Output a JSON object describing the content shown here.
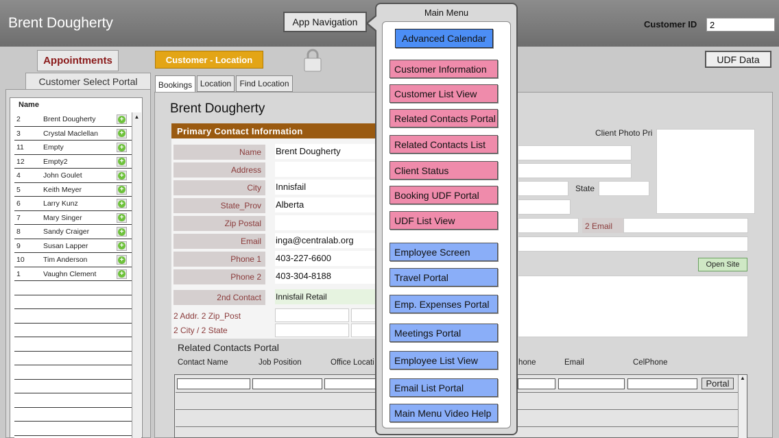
{
  "header": {
    "title": "Brent Dougherty",
    "nav_button": "App Navigation",
    "customer_id_label": "Customer ID",
    "customer_id_value": "2"
  },
  "subbar": {
    "appointments_tab": "Appointments",
    "customer_location": "Customer - Location",
    "udf_button": "UDF Data"
  },
  "left": {
    "portal_label": "Customer Select Portal",
    "list_header": "Name",
    "rows": [
      {
        "id": "2",
        "name": "Brent Dougherty"
      },
      {
        "id": "3",
        "name": "Crystal Maclellan"
      },
      {
        "id": "11",
        "name": "Empty"
      },
      {
        "id": "12",
        "name": "Empty2"
      },
      {
        "id": "4",
        "name": "John Goulet"
      },
      {
        "id": "5",
        "name": "Keith Meyer"
      },
      {
        "id": "6",
        "name": "Larry Kunz"
      },
      {
        "id": "7",
        "name": "Mary Singer"
      },
      {
        "id": "8",
        "name": "Sandy Craiger"
      },
      {
        "id": "9",
        "name": "Susan Lapper"
      },
      {
        "id": "10",
        "name": "Tim Anderson"
      },
      {
        "id": "1",
        "name": "Vaughn Clement"
      }
    ]
  },
  "tabs": [
    "Bookings",
    "Location",
    "Find Location"
  ],
  "main": {
    "person_name": "Brent Dougherty",
    "section_title": "Primary Contact  Information",
    "fields": [
      {
        "label": "Name",
        "value": "Brent Dougherty"
      },
      {
        "label": "Address",
        "value": ""
      },
      {
        "label": "City",
        "value": "Innisfail"
      },
      {
        "label": "State_Prov",
        "value": "Alberta"
      },
      {
        "label": "Zip Postal",
        "value": ""
      },
      {
        "label": "Email",
        "value": "inga@centralab.org"
      },
      {
        "label": "Phone 1",
        "value": "403-227-6600"
      },
      {
        "label": "Phone 2",
        "value": "403-304-8188"
      },
      {
        "label": "2nd  Contact",
        "value": "Innisfail Retail"
      }
    ],
    "addr2_label": "2 Addr. 2 Zip_Post",
    "city2_label": "2 City / 2 State",
    "client_photo_label": "Client Photo Pri",
    "state_label": "State",
    "email2_label": "2 Email",
    "open_site": "Open Site",
    "related_title": "Related Contacts Portal",
    "related_columns": [
      "Contact Name",
      "Job Position",
      "Office Locati",
      "hone",
      "Email",
      "CelPhone"
    ],
    "portal_button": "Portal"
  },
  "menu": {
    "title": "Main Menu",
    "calendar": "Advanced Calendar",
    "pink_items": [
      "Customer Information",
      "Customer List View",
      "Related Contacts Portal",
      "Related Contacts List",
      "Client Status",
      "Booking UDF Portal",
      "UDF List View"
    ],
    "blue_items": [
      "Employee Screen",
      "Travel Portal",
      "Emp. Expenses Portal",
      "Meetings Portal",
      "Employee List View",
      "Email List Portal",
      "Main Menu Video Help"
    ]
  },
  "colors": {
    "accent_orange": "#e3a516",
    "section_brown": "#9a5a10",
    "menu_pink": "#ef8bab",
    "menu_blue": "#8aaef8",
    "calendar_blue": "#4c8ef5"
  }
}
